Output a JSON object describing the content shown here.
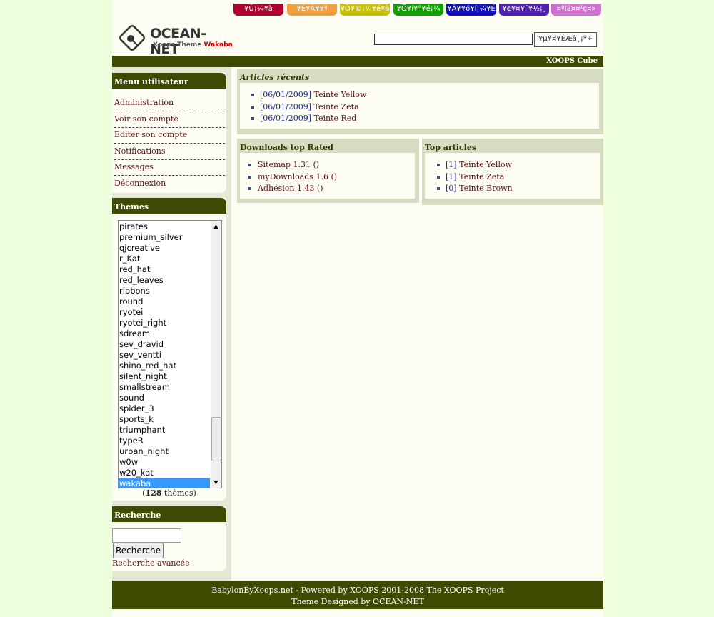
{
  "tabs": [
    {
      "label": "¥Û¡¼¥à",
      "color": "#b00030"
    },
    {
      "label": "¥É¥Á¥¥ª",
      "color": "#f0a040"
    },
    {
      "label": "¥Õ¥©¡¼¥é¥à",
      "color": "#c8c000"
    },
    {
      "label": "¥Ö¥í¥°¥é¡¼",
      "color": "#10a000"
    },
    {
      "label": "¥À¥¥ó¥í¡¼¥É",
      "color": "#1010c0"
    },
    {
      "label": "¥¢¥¤¥¯¥½¡¸",
      "color": "#5020b0"
    },
    {
      "label": "¤ªÌä¤¤¹ç¤»",
      "color": "#d070d0"
    }
  ],
  "logo": {
    "title": "OCEAN-NET",
    "subtitle": "Xoops Theme",
    "subtitle_accent": "Wakaba"
  },
  "header_search": {
    "value": "",
    "button_label": "¥µ¥¤¥ÈÆâ¸¡º÷"
  },
  "header_bar": {
    "link": "XOOPS Cube"
  },
  "user_menu": {
    "title": "Menu utilisateur",
    "items": [
      "Administration",
      "Voir son compte",
      "Editer son compte",
      "Notifications",
      "Messages",
      "Déconnexion"
    ]
  },
  "themes": {
    "title": "Themes",
    "options": [
      "pirates",
      "premium_silver",
      "qjcreative",
      "r_Kat",
      "red_hat",
      "red_leaves",
      "ribbons",
      "round",
      "ryotei",
      "ryotei_right",
      "sdream",
      "sev_dravid",
      "sev_ventti",
      "shino_red_hat",
      "silent_night",
      "smallstream",
      "sound",
      "spider_3",
      "sports_k",
      "triumphant",
      "typeR",
      "urban_night",
      "w0w",
      "w20_kat",
      "wakaba"
    ],
    "selected": "wakaba",
    "count_prefix": "(",
    "count": "128",
    "count_suffix": " thèmes)"
  },
  "search": {
    "title": "Recherche",
    "value": "",
    "button_label": "Recherche",
    "advanced_link": "Recherche avancée"
  },
  "recent_articles": {
    "title": "Articles récents",
    "items": [
      {
        "date": "[06/01/2009]",
        "title": "Teinte Yellow"
      },
      {
        "date": "[06/01/2009]",
        "title": "Teinte Zeta"
      },
      {
        "date": "[06/01/2009]",
        "title": "Teinte Red"
      }
    ]
  },
  "downloads": {
    "title": "Downloads top Rated",
    "items": [
      "Sitemap 1.31 ()",
      "myDownloads 1.6 ()",
      "Adhésion 1.43 ()"
    ]
  },
  "top_articles": {
    "title": "Top articles",
    "items": [
      {
        "rank": "[1]",
        "title": "Teinte Yellow"
      },
      {
        "rank": "[1]",
        "title": "Teinte Zeta"
      },
      {
        "rank": "[0]",
        "title": "Teinte Brown"
      }
    ]
  },
  "footer": {
    "line1": "BabylonByXoops.net - Powered by XOOPS 2001-2008 The XOOPS Project",
    "line2_prefix": "Theme Designed by ",
    "line2_link": "OCEAN-NET"
  }
}
